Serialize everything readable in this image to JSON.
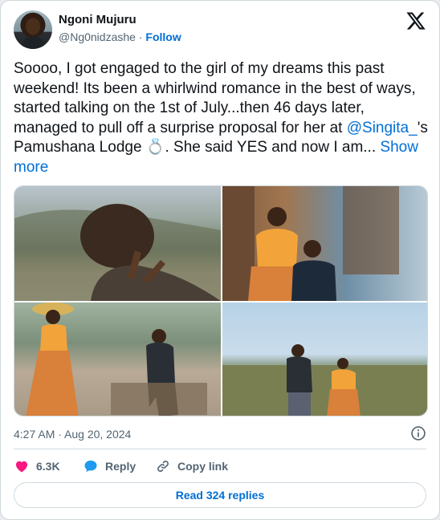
{
  "author": {
    "display_name": "Ngoni Mujuru",
    "handle": "@Ng0nidzashe",
    "separator": "·",
    "follow_label": "Follow"
  },
  "post": {
    "text_1": "Soooo, I got engaged to the girl of my dreams this past weekend! Its been a whirlwind romance in the best of ways, started talking on the 1st of July...then 46 days later, managed to pull off a surprise proposal for her at ",
    "mention": "@Singita_",
    "text_2": "'s Pamushana Lodge ",
    "emoji": "💍",
    "text_3": ". She said YES and now I am... ",
    "show_more": "Show more"
  },
  "meta": {
    "timestamp": "4:27 AM · Aug 20, 2024"
  },
  "actions": {
    "like_count": "6.3K",
    "reply_label": "Reply",
    "copy_label": "Copy link"
  },
  "read_replies_label": "Read 324 replies",
  "colors": {
    "accent": "#006fd6",
    "like": "#f91880",
    "reply": "#1d9bf0",
    "muted": "#536471"
  }
}
